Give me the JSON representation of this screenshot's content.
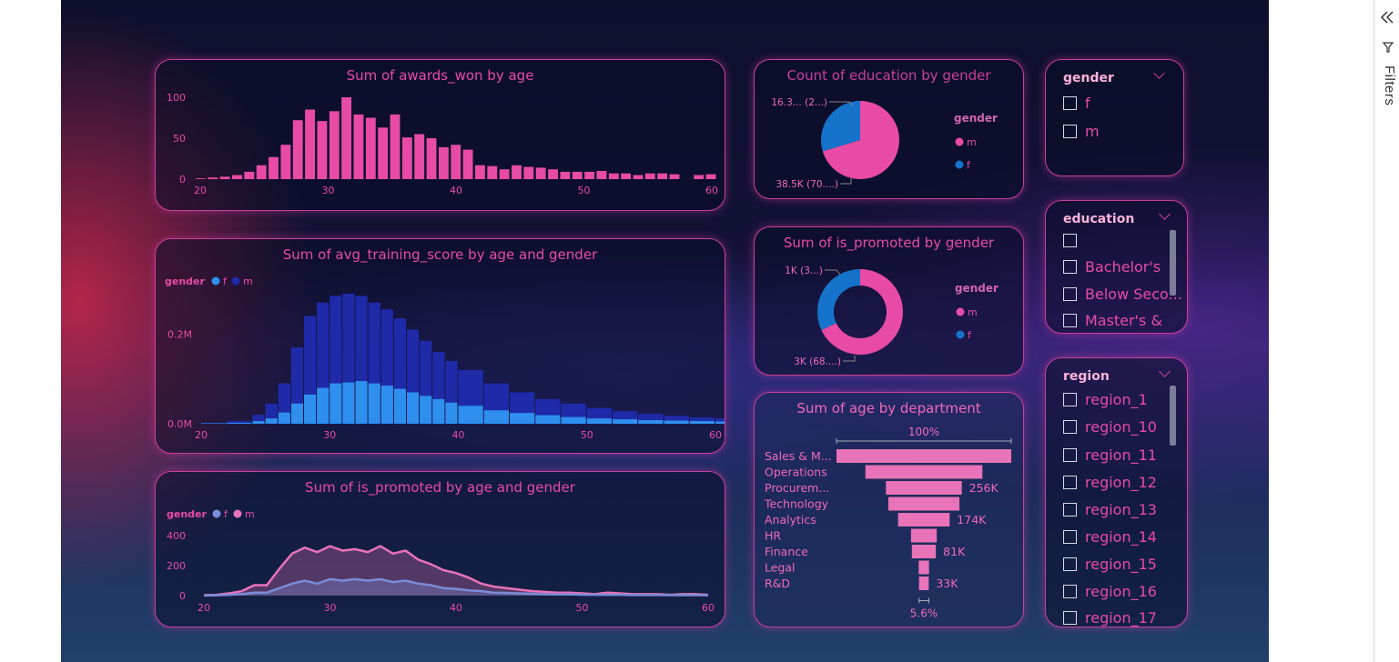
{
  "filters_pane": {
    "label": "Filters",
    "collapse_icon": "double-chevron-left-icon",
    "filter_icon": "funnel-icon"
  },
  "awards_chart": {
    "title": "Sum of awards_won by age",
    "chart_data": {
      "type": "bar",
      "title": "Sum of awards_won by age",
      "x": [
        20,
        21,
        22,
        23,
        24,
        25,
        26,
        27,
        28,
        29,
        30,
        31,
        32,
        33,
        34,
        35,
        36,
        37,
        38,
        39,
        40,
        41,
        42,
        43,
        44,
        45,
        46,
        47,
        48,
        49,
        50,
        51,
        52,
        53,
        54,
        55,
        56,
        57,
        58,
        59,
        60
      ],
      "values": [
        1,
        2,
        3,
        5,
        9,
        17,
        27,
        42,
        72,
        85,
        71,
        83,
        100,
        79,
        75,
        63,
        79,
        51,
        55,
        50,
        39,
        42,
        36,
        17,
        16,
        12,
        17,
        15,
        14,
        12,
        9,
        9,
        9,
        10,
        7,
        7,
        5,
        7,
        7,
        6,
        0,
        5,
        6
      ],
      "x_ticks": [
        "20",
        "30",
        "40",
        "50",
        "60"
      ],
      "y_ticks": [
        "0",
        "50",
        "100"
      ],
      "ylim": [
        0,
        100
      ],
      "color": "#e84ba6"
    }
  },
  "training_chart": {
    "title": "Sum of avg_training_score by age and gender",
    "legend_title": "gender",
    "legend": [
      {
        "label": "f",
        "color": "#2e8fef"
      },
      {
        "label": "m",
        "color": "#1e2aa8"
      }
    ],
    "chart_data": {
      "type": "bar",
      "title": "Sum of avg_training_score by age and gender",
      "x_ticks": [
        "20",
        "30",
        "40",
        "50",
        "60"
      ],
      "y_ticks": [
        "0.0M",
        "0.2M"
      ],
      "xlim": [
        20,
        60
      ],
      "ylim": [
        0,
        0.3
      ],
      "series": [
        {
          "name": "m",
          "color": "#1e2aa8",
          "x": [
            20,
            22,
            24,
            25,
            26,
            27,
            28,
            29,
            30,
            31,
            32,
            33,
            34,
            35,
            36,
            37,
            38,
            39,
            40,
            42,
            44,
            46,
            48,
            50,
            52,
            54,
            56,
            58,
            60
          ],
          "values": [
            0.002,
            0.006,
            0.02,
            0.045,
            0.09,
            0.17,
            0.24,
            0.27,
            0.285,
            0.29,
            0.285,
            0.27,
            0.255,
            0.235,
            0.21,
            0.185,
            0.16,
            0.14,
            0.12,
            0.09,
            0.07,
            0.055,
            0.045,
            0.035,
            0.028,
            0.022,
            0.018,
            0.014,
            0.012
          ]
        },
        {
          "name": "f",
          "color": "#2e8fef",
          "x": [
            20,
            22,
            24,
            25,
            26,
            27,
            28,
            29,
            30,
            31,
            32,
            33,
            34,
            35,
            36,
            37,
            38,
            39,
            40,
            42,
            44,
            46,
            48,
            50,
            52,
            54,
            56,
            58,
            60
          ],
          "values": [
            0.001,
            0.002,
            0.006,
            0.012,
            0.025,
            0.045,
            0.065,
            0.08,
            0.09,
            0.092,
            0.095,
            0.09,
            0.085,
            0.078,
            0.07,
            0.062,
            0.055,
            0.047,
            0.04,
            0.03,
            0.024,
            0.019,
            0.015,
            0.012,
            0.01,
            0.008,
            0.007,
            0.006,
            0.005
          ]
        }
      ]
    }
  },
  "promoted_chart": {
    "title": "Sum of is_promoted by age and gender",
    "legend_title": "gender",
    "legend": [
      {
        "label": "f",
        "color": "#7b8cd8"
      },
      {
        "label": "m",
        "color": "#e873b9"
      }
    ],
    "chart_data": {
      "type": "area",
      "title": "Sum of is_promoted by age and gender",
      "x_ticks": [
        "20",
        "30",
        "40",
        "50",
        "60"
      ],
      "y_ticks": [
        "0",
        "200",
        "400"
      ],
      "xlim": [
        20,
        60
      ],
      "ylim": [
        0,
        400
      ],
      "series": [
        {
          "name": "m",
          "color": "#e873b9",
          "x": [
            20,
            21,
            22,
            23,
            24,
            25,
            26,
            27,
            28,
            29,
            30,
            31,
            32,
            33,
            34,
            35,
            36,
            37,
            38,
            39,
            40,
            41,
            42,
            43,
            44,
            45,
            46,
            47,
            48,
            49,
            50,
            51,
            52,
            53,
            54,
            55,
            56,
            57,
            58,
            59,
            60
          ],
          "values": [
            3,
            5,
            15,
            30,
            70,
            70,
            180,
            280,
            320,
            290,
            330,
            300,
            310,
            290,
            330,
            280,
            300,
            240,
            210,
            170,
            150,
            120,
            80,
            60,
            50,
            40,
            30,
            25,
            20,
            20,
            15,
            10,
            20,
            15,
            10,
            10,
            10,
            5,
            10,
            10,
            5
          ]
        },
        {
          "name": "f",
          "color": "#7b8cd8",
          "x": [
            20,
            21,
            22,
            23,
            24,
            25,
            26,
            27,
            28,
            29,
            30,
            31,
            32,
            33,
            34,
            35,
            36,
            37,
            38,
            39,
            40,
            41,
            42,
            43,
            44,
            45,
            46,
            47,
            48,
            49,
            50,
            51,
            52,
            53,
            54,
            55,
            56,
            57,
            58,
            59,
            60
          ],
          "values": [
            0,
            2,
            5,
            10,
            20,
            20,
            50,
            80,
            100,
            80,
            110,
            100,
            110,
            100,
            110,
            90,
            100,
            80,
            70,
            50,
            45,
            35,
            30,
            20,
            18,
            15,
            12,
            10,
            8,
            8,
            6,
            5,
            6,
            5,
            4,
            4,
            4,
            3,
            4,
            3,
            2
          ]
        }
      ]
    }
  },
  "education_pie": {
    "title": "Count of education by gender",
    "legend_title": "gender",
    "legend": [
      {
        "label": "m",
        "color": "#e84ba6"
      },
      {
        "label": "f",
        "color": "#1573c9"
      }
    ],
    "labels": {
      "small": "16.3... (2...)",
      "large": "38.5K (70....)"
    },
    "chart_data": {
      "type": "pie",
      "title": "Count of education by gender",
      "slices": [
        {
          "label": "m",
          "value": 38500,
          "share": 0.703,
          "color": "#e84ba6"
        },
        {
          "label": "f",
          "value": 16300,
          "share": 0.297,
          "color": "#1573c9"
        }
      ]
    }
  },
  "promoted_donut": {
    "title": "Sum of is_promoted by gender",
    "legend_title": "gender",
    "legend": [
      {
        "label": "m",
        "color": "#e84ba6"
      },
      {
        "label": "f",
        "color": "#1573c9"
      }
    ],
    "labels": {
      "small": "1K (3...)",
      "large": "3K (68....)"
    },
    "chart_data": {
      "type": "pie",
      "title": "Sum of is_promoted by gender",
      "slices": [
        {
          "label": "m",
          "value": 3000,
          "share": 0.68,
          "color": "#e84ba6"
        },
        {
          "label": "f",
          "value": 1000,
          "share": 0.32,
          "color": "#1573c9"
        }
      ]
    }
  },
  "department_funnel": {
    "title": "Sum of age by department",
    "top_label": "100%",
    "bottom_label": "5.6%",
    "chart_data": {
      "type": "bar",
      "title": "Sum of age by department",
      "categories": [
        "Sales & M...",
        "Operations",
        "Procurem...",
        "Technology",
        "Analytics",
        "HR",
        "Finance",
        "Legal",
        "R&D"
      ],
      "values": [
        590,
        395,
        256,
        240,
        174,
        87,
        81,
        35,
        33
      ],
      "value_labels": [
        "",
        "",
        "256K",
        "",
        "174K",
        "",
        "81K",
        "",
        "33K"
      ],
      "units": "K",
      "color": "#e873b9"
    }
  },
  "slicers": {
    "gender": {
      "title": "gender",
      "items": [
        "f",
        "m"
      ]
    },
    "education": {
      "title": "education",
      "items": [
        "",
        "Bachelor's",
        "Below Seco...",
        "Master's &"
      ]
    },
    "region": {
      "title": "region",
      "items": [
        "region_1",
        "region_10",
        "region_11",
        "region_12",
        "region_13",
        "region_14",
        "region_15",
        "region_16",
        "region_17"
      ]
    }
  }
}
